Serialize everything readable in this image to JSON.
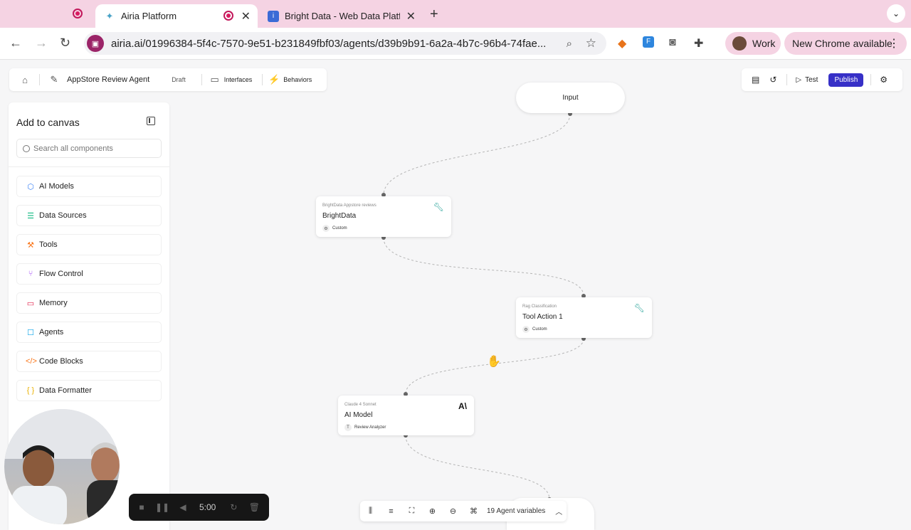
{
  "browser": {
    "tabs": [
      {
        "title": "Airia Platform",
        "active": true
      },
      {
        "title": "Bright Data - Web Data Platfo",
        "active": false
      }
    ],
    "new_tab": "+",
    "tab_menu_icon": "chevron-down-icon",
    "url": "airia.ai/01996384-5f4c-7570-9e51-b231849fbf03/agents/d39b9b91-6a2a-4b7c-96b4-74fae...",
    "profile_label": "Work",
    "update_label": "New Chrome available",
    "accent_color": "#f5d3e3"
  },
  "app": {
    "home_icon": "home-icon",
    "agent_name": "AppStore Review Agent",
    "status": "Draft",
    "interfaces_label": "Interfaces",
    "behaviors_label": "Behaviors",
    "test_label": "Test",
    "publish_label": "Publish",
    "publish_color": "#3730c7"
  },
  "sidebar": {
    "title": "Add to canvas",
    "search_placeholder": "Search all components",
    "items": [
      {
        "label": "AI Models",
        "icon": "cube-icon",
        "color": "#3b82f6"
      },
      {
        "label": "Data Sources",
        "icon": "database-icon",
        "color": "#10b981"
      },
      {
        "label": "Tools",
        "icon": "wrench-icon",
        "color": "#f97316"
      },
      {
        "label": "Flow Control",
        "icon": "flow-icon",
        "color": "#a855f7"
      },
      {
        "label": "Memory",
        "icon": "memory-icon",
        "color": "#e11d48"
      },
      {
        "label": "Agents",
        "icon": "bot-icon",
        "color": "#0ea5e9"
      },
      {
        "label": "Code Blocks",
        "icon": "code-icon",
        "color": "#f97316"
      },
      {
        "label": "Data Formatter",
        "icon": "braces-icon",
        "color": "#eab308"
      }
    ]
  },
  "canvas": {
    "input_node": "Input",
    "nodes": [
      {
        "sub": "BrightData Appstore reviews",
        "name": "BrightData",
        "meta": "Custom",
        "icon": "wrench-icon"
      },
      {
        "sub": "Rag Classification",
        "name": "Tool Action 1",
        "meta": "Custom",
        "icon": "wrench-icon"
      },
      {
        "sub": "Claude 4 Sonnet",
        "name": "AI Model",
        "meta": "Review Analyzer",
        "meta_badge": "T",
        "icon": "anthropic-icon",
        "brand": "A\\"
      }
    ]
  },
  "bottom_toolbar": {
    "variables_label": "19 Agent variables"
  },
  "recorder": {
    "time": "5:00"
  }
}
